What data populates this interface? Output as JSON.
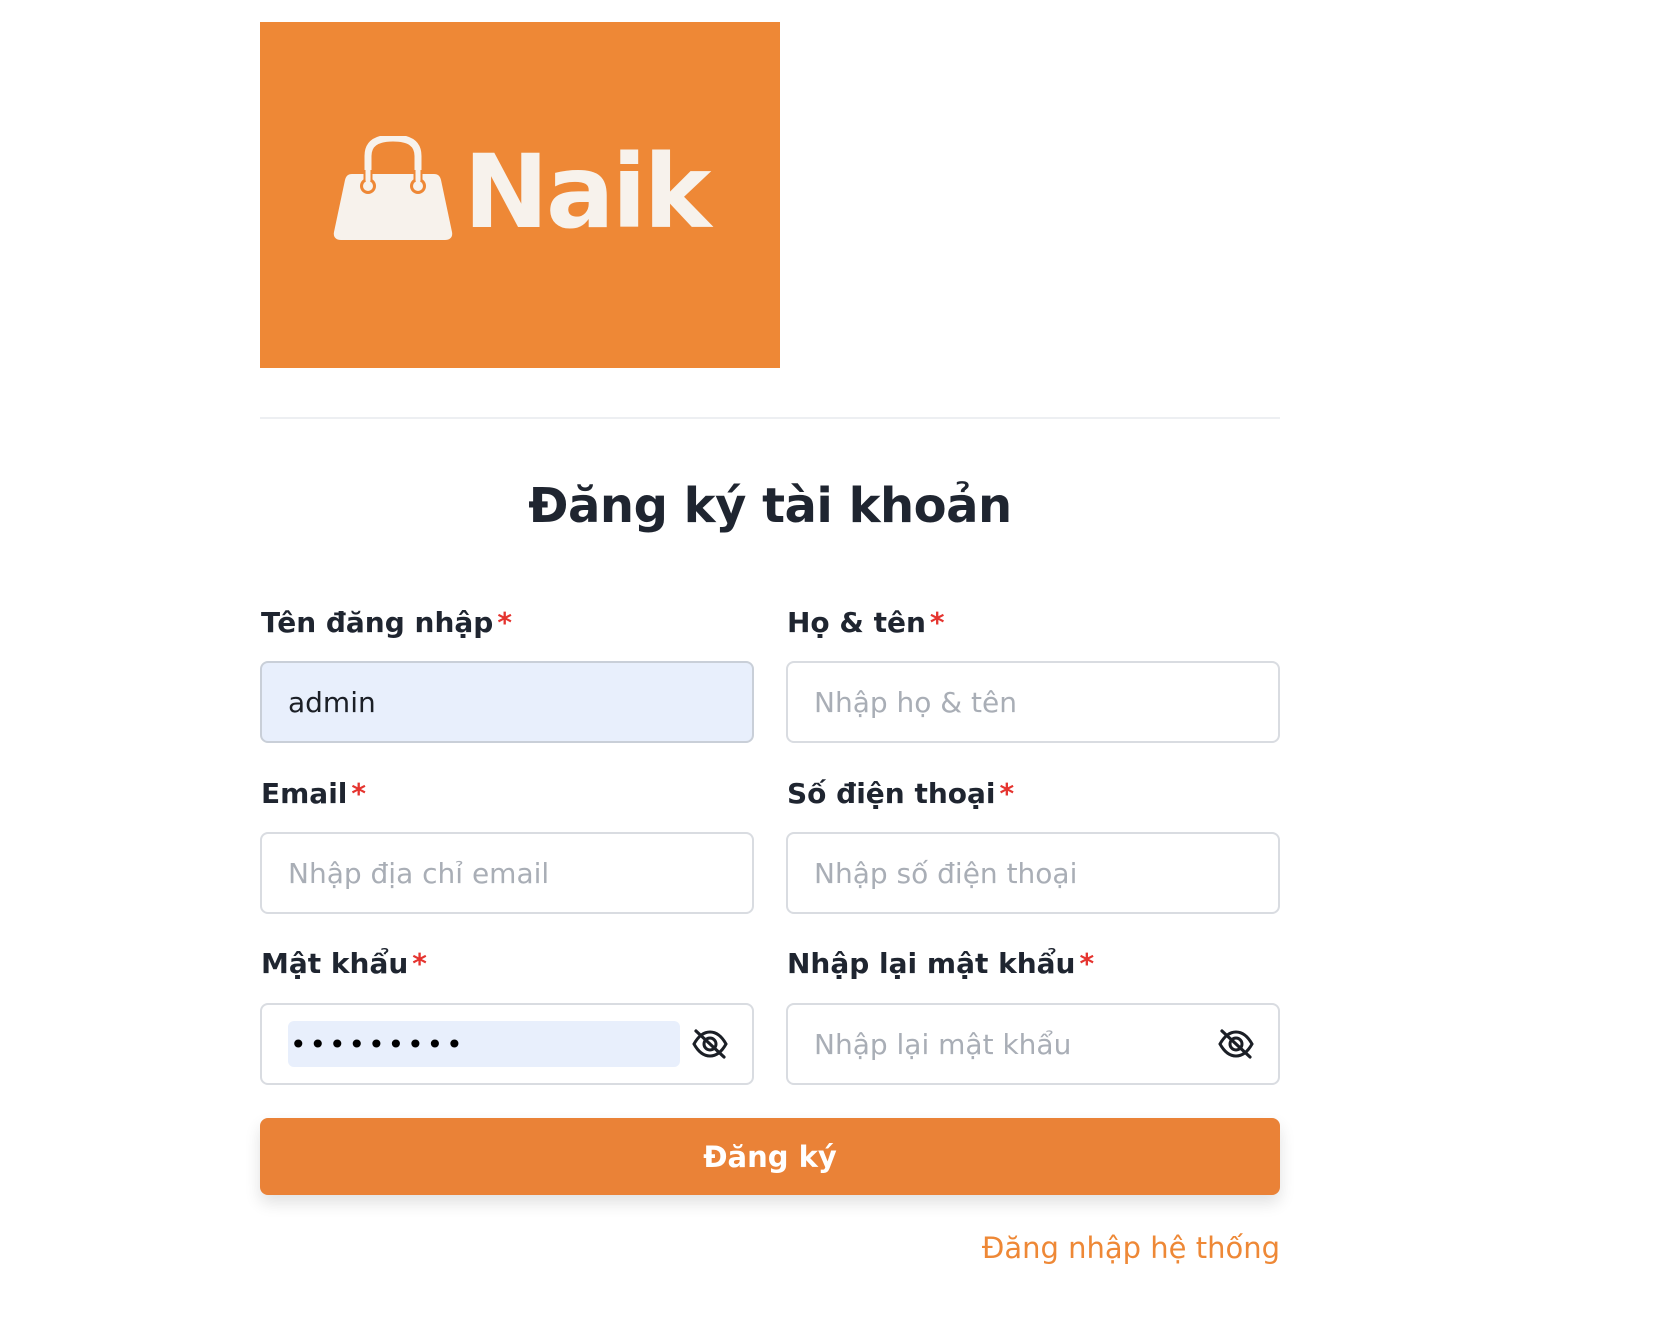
{
  "brand": {
    "name": "Naik",
    "accent_color": "#ee8836",
    "icon": "shopping-bag-icon"
  },
  "form": {
    "title": "Đăng ký tài khoản",
    "required_marker": "*",
    "fields": {
      "username": {
        "label": "Tên đăng nhập",
        "value": "admin",
        "placeholder": ""
      },
      "fullname": {
        "label": "Họ & tên",
        "value": "",
        "placeholder": "Nhập họ & tên"
      },
      "email": {
        "label": "Email",
        "value": "",
        "placeholder": "Nhập địa chỉ email"
      },
      "phone": {
        "label": "Số điện thoại",
        "value": "",
        "placeholder": "Nhập số điện thoại"
      },
      "password": {
        "label": "Mật khẩu",
        "value": "•••••••••",
        "placeholder": "",
        "toggle_icon": "eye-slash-icon"
      },
      "confirm_password": {
        "label": "Nhập lại mật khẩu",
        "value": "",
        "placeholder": "Nhập lại mật khẩu",
        "toggle_icon": "eye-slash-icon"
      }
    },
    "submit_label": "Đăng ký",
    "login_link": "Đăng nhập hệ thống"
  }
}
